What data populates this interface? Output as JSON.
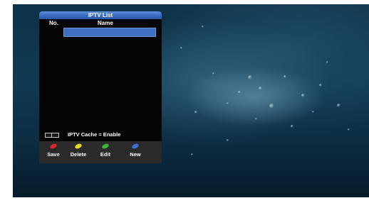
{
  "panel": {
    "title": "IPTV List",
    "columns": {
      "no": "No.",
      "name": "Name"
    },
    "cache_status": "IPTV Cache = Enable"
  },
  "buttons": [
    {
      "label": "Save",
      "color": "#d8262a"
    },
    {
      "label": "Delete",
      "color": "#e3d91f"
    },
    {
      "label": "Edit",
      "color": "#3fae3a"
    },
    {
      "label": "New",
      "color": "#3b6fd8"
    }
  ],
  "colors": {
    "title_bar": "#3568bd",
    "selection": "#3f6fc0",
    "panel_bg": "#050505"
  }
}
